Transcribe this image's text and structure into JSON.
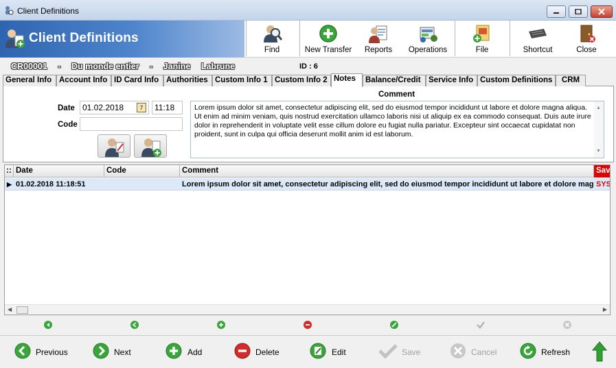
{
  "window": {
    "title": "Client Definitions"
  },
  "header": {
    "title": "Client Definitions",
    "toolbar": [
      {
        "label": "Find",
        "icon": "find-icon"
      },
      {
        "label": "New Transfer",
        "icon": "new-transfer-icon"
      },
      {
        "label": "Reports",
        "icon": "reports-icon"
      },
      {
        "label": "Operations",
        "icon": "operations-icon"
      },
      {
        "label": "File",
        "icon": "file-icon"
      },
      {
        "label": "Shortcut",
        "icon": "shortcut-icon"
      },
      {
        "label": "Close",
        "icon": "close-door-icon"
      }
    ]
  },
  "record": {
    "code": "CR00001",
    "sep1": "-",
    "name": "Du monde entier",
    "sep2": "-",
    "first_name": "Janine",
    "last_name": "Labrune",
    "id_label": "ID : 6"
  },
  "tabs": [
    {
      "label": "General Info",
      "active": false
    },
    {
      "label": "Account Info",
      "active": false
    },
    {
      "label": "ID Card Info",
      "active": false
    },
    {
      "label": "Authorities",
      "active": false
    },
    {
      "label": "Custom Info 1",
      "active": false
    },
    {
      "label": "Custom Info 2",
      "active": false
    },
    {
      "label": "Notes",
      "active": true
    },
    {
      "label": "Balance/Credit",
      "active": false
    },
    {
      "label": "Service Info",
      "active": false
    },
    {
      "label": "Custom Definitions",
      "active": false
    },
    {
      "label": "CRM",
      "active": false
    }
  ],
  "notes_form": {
    "date_label": "Date",
    "date_value": "01.02.2018",
    "calendar_glyph": "7",
    "time_value": "11:18",
    "code_label": "Code",
    "code_value": "",
    "comment_label": "Comment",
    "comment_value": "Lorem ipsum dolor sit amet, consectetur adipiscing elit, sed do eiusmod tempor incididunt ut labore et dolore magna aliqua. Ut enim ad minim veniam, quis nostrud exercitation ullamco laboris nisi ut aliquip ex ea commodo consequat. Duis aute irure dolor in reprehenderit in voluptate velit esse cillum dolore eu fugiat nulla pariatur. Excepteur sint occaecat cupidatat non proident, sunt in culpa qui officia deserunt mollit anim id est laborum."
  },
  "grid": {
    "indicator_header": "::",
    "columns": [
      "Date",
      "Code",
      "Comment",
      "Sav"
    ],
    "rows": [
      {
        "marker": "▶",
        "date": "01.02.2018 11:18:51",
        "code": "",
        "comment": "Lorem ipsum dolor sit amet, consectetur adipiscing elit, sed do eiusmod tempor incididunt ut labore et dolore magna aliqua.",
        "saved_by": "SYS"
      }
    ]
  },
  "bottom": {
    "buttons": [
      {
        "label": "Previous",
        "enabled": true
      },
      {
        "label": "Next",
        "enabled": true
      },
      {
        "label": "Add",
        "enabled": true
      },
      {
        "label": "Delete",
        "enabled": true
      },
      {
        "label": "Edit",
        "enabled": true
      },
      {
        "label": "Save",
        "enabled": false
      },
      {
        "label": "Cancel",
        "enabled": false
      },
      {
        "label": "Refresh",
        "enabled": true
      }
    ]
  },
  "colors": {
    "banner": "#2f64b0",
    "green": "#3aa53a",
    "red": "#d42b2b",
    "selected_row": "#dce9f8",
    "sav_header": "#e00000"
  }
}
